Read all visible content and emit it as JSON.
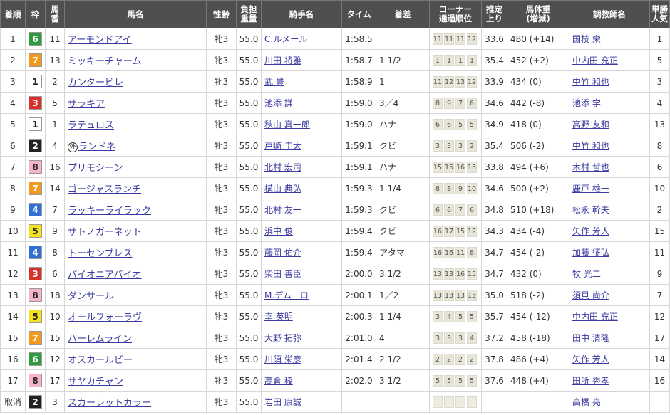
{
  "headers": [
    "着順",
    "枠",
    "馬番",
    "馬名",
    "性齢",
    "負担重量",
    "騎手名",
    "タイム",
    "着差",
    "コーナー通過順位",
    "推定上り",
    "馬体重(増減)",
    "調教師名",
    "単勝人気"
  ],
  "header_lines": {
    "umaban": [
      "馬",
      "番"
    ],
    "futan": [
      "負担",
      "重量"
    ],
    "corner": [
      "コーナー",
      "通過順位"
    ],
    "agari": [
      "推定",
      "上り"
    ],
    "weight": [
      "馬体重",
      "(増減)"
    ],
    "ninki": [
      "単勝",
      "人気"
    ]
  },
  "colors": {
    "header_bg": "#4f4f4f",
    "waku_1": "#ffffff",
    "waku_2": "#222222",
    "waku_3": "#d9302a",
    "waku_4": "#2f6fd6",
    "waku_5": "#f6e21c",
    "waku_6": "#2f9a3f",
    "waku_7": "#f39a1d",
    "waku_8": "#f7b4c8",
    "link": "#3a3aa0"
  },
  "rows": [
    {
      "pos": "1",
      "waku": "6",
      "uma": "11",
      "name": "アーモンドアイ",
      "prefix": "",
      "sex": "牝3",
      "kg": "55.0",
      "jockey": "C.ルメール",
      "time": "1:58.5",
      "margin": "",
      "corner": [
        "11",
        "11",
        "11",
        "12"
      ],
      "agari": "33.6",
      "weight": "480 (+14)",
      "trainer": "国枝 栄",
      "ninki": "1"
    },
    {
      "pos": "2",
      "waku": "7",
      "uma": "13",
      "name": "ミッキーチャーム",
      "prefix": "",
      "sex": "牝3",
      "kg": "55.0",
      "jockey": "川田 将雅",
      "time": "1:58.7",
      "margin": "1 1/2",
      "corner": [
        "1",
        "1",
        "1",
        "1"
      ],
      "agari": "35.4",
      "weight": "452 (+2)",
      "trainer": "中内田 充正",
      "ninki": "5"
    },
    {
      "pos": "3",
      "waku": "1",
      "uma": "2",
      "name": "カンタービレ",
      "prefix": "",
      "sex": "牝3",
      "kg": "55.0",
      "jockey": "武 豊",
      "time": "1:58.9",
      "margin": "1",
      "corner": [
        "11",
        "12",
        "13",
        "12"
      ],
      "agari": "33.9",
      "weight": "434 (0)",
      "trainer": "中竹 和也",
      "ninki": "3"
    },
    {
      "pos": "4",
      "waku": "3",
      "uma": "5",
      "name": "サラキア",
      "prefix": "",
      "sex": "牝3",
      "kg": "55.0",
      "jockey": "池添 謙一",
      "time": "1:59.0",
      "margin": "3／4",
      "corner": [
        "8",
        "9",
        "7",
        "6"
      ],
      "agari": "34.6",
      "weight": "442 (-8)",
      "trainer": "池添 学",
      "ninki": "4"
    },
    {
      "pos": "5",
      "waku": "1",
      "uma": "1",
      "name": "ラテュロス",
      "prefix": "",
      "sex": "牝3",
      "kg": "55.0",
      "jockey": "秋山 真一郎",
      "time": "1:59.0",
      "margin": "ハナ",
      "corner": [
        "6",
        "6",
        "5",
        "5"
      ],
      "agari": "34.9",
      "weight": "418 (0)",
      "trainer": "高野 友和",
      "ninki": "13"
    },
    {
      "pos": "6",
      "waku": "2",
      "uma": "4",
      "name": "ランドネ",
      "prefix": "外",
      "sex": "牝3",
      "kg": "55.0",
      "jockey": "戸崎 圭太",
      "time": "1:59.1",
      "margin": "クビ",
      "corner": [
        "3",
        "3",
        "3",
        "2"
      ],
      "agari": "35.4",
      "weight": "506 (-2)",
      "trainer": "中竹 和也",
      "ninki": "8"
    },
    {
      "pos": "7",
      "waku": "8",
      "uma": "16",
      "name": "プリモシーン",
      "prefix": "",
      "sex": "牝3",
      "kg": "55.0",
      "jockey": "北村 宏司",
      "time": "1:59.1",
      "margin": "ハナ",
      "corner": [
        "15",
        "15",
        "16",
        "15"
      ],
      "agari": "33.8",
      "weight": "494 (+6)",
      "trainer": "木村 哲也",
      "ninki": "6"
    },
    {
      "pos": "8",
      "waku": "7",
      "uma": "14",
      "name": "ゴージャスランチ",
      "prefix": "",
      "sex": "牝3",
      "kg": "55.0",
      "jockey": "横山 典弘",
      "time": "1:59.3",
      "margin": "1 1/4",
      "corner": [
        "8",
        "8",
        "9",
        "10"
      ],
      "agari": "34.6",
      "weight": "500 (+2)",
      "trainer": "鹿戸 雄一",
      "ninki": "10"
    },
    {
      "pos": "9",
      "waku": "4",
      "uma": "7",
      "name": "ラッキーライラック",
      "prefix": "",
      "sex": "牝3",
      "kg": "55.0",
      "jockey": "北村 友一",
      "time": "1:59.3",
      "margin": "クビ",
      "corner": [
        "6",
        "6",
        "7",
        "6"
      ],
      "agari": "34.8",
      "weight": "510 (+18)",
      "trainer": "松永 幹夫",
      "ninki": "2"
    },
    {
      "pos": "10",
      "waku": "5",
      "uma": "9",
      "name": "サトノガーネット",
      "prefix": "",
      "sex": "牝3",
      "kg": "55.0",
      "jockey": "浜中 俊",
      "time": "1:59.4",
      "margin": "クビ",
      "corner": [
        "16",
        "17",
        "15",
        "12"
      ],
      "agari": "34.3",
      "weight": "434 (-4)",
      "trainer": "矢作 芳人",
      "ninki": "15"
    },
    {
      "pos": "11",
      "waku": "4",
      "uma": "8",
      "name": "トーセンブレス",
      "prefix": "",
      "sex": "牝3",
      "kg": "55.0",
      "jockey": "藤岡 佑介",
      "time": "1:59.4",
      "margin": "アタマ",
      "corner": [
        "16",
        "16",
        "11",
        "8"
      ],
      "agari": "34.7",
      "weight": "454 (-2)",
      "trainer": "加藤 征弘",
      "ninki": "11"
    },
    {
      "pos": "12",
      "waku": "3",
      "uma": "6",
      "name": "パイオニアバイオ",
      "prefix": "",
      "sex": "牝3",
      "kg": "55.0",
      "jockey": "柴田 善臣",
      "time": "2:00.0",
      "margin": "3 1/2",
      "corner": [
        "13",
        "13",
        "16",
        "15"
      ],
      "agari": "34.7",
      "weight": "432 (0)",
      "trainer": "牧 光二",
      "ninki": "9"
    },
    {
      "pos": "13",
      "waku": "8",
      "uma": "18",
      "name": "ダンサール",
      "prefix": "",
      "sex": "牝3",
      "kg": "55.0",
      "jockey": "M.デムーロ",
      "time": "2:00.1",
      "margin": "1／2",
      "corner": [
        "13",
        "13",
        "13",
        "15"
      ],
      "agari": "35.0",
      "weight": "518 (-2)",
      "trainer": "須貝 尚介",
      "ninki": "7"
    },
    {
      "pos": "14",
      "waku": "5",
      "uma": "10",
      "name": "オールフォーラヴ",
      "prefix": "",
      "sex": "牝3",
      "kg": "55.0",
      "jockey": "幸 英明",
      "time": "2:00.3",
      "margin": "1 1/4",
      "corner": [
        "3",
        "4",
        "5",
        "5"
      ],
      "agari": "35.7",
      "weight": "454 (-12)",
      "trainer": "中内田 充正",
      "ninki": "12"
    },
    {
      "pos": "15",
      "waku": "7",
      "uma": "15",
      "name": "ハーレムライン",
      "prefix": "",
      "sex": "牝3",
      "kg": "55.0",
      "jockey": "大野 拓弥",
      "time": "2:01.0",
      "margin": "4",
      "corner": [
        "3",
        "3",
        "3",
        "4"
      ],
      "agari": "37.2",
      "weight": "458 (-18)",
      "trainer": "田中 清隆",
      "ninki": "17"
    },
    {
      "pos": "16",
      "waku": "6",
      "uma": "12",
      "name": "オスカールビー",
      "prefix": "",
      "sex": "牝3",
      "kg": "55.0",
      "jockey": "川須 栄彦",
      "time": "2:01.4",
      "margin": "2 1/2",
      "corner": [
        "2",
        "2",
        "2",
        "2"
      ],
      "agari": "37.8",
      "weight": "486 (+4)",
      "trainer": "矢作 芳人",
      "ninki": "14"
    },
    {
      "pos": "17",
      "waku": "8",
      "uma": "17",
      "name": "サヤカチャン",
      "prefix": "",
      "sex": "牝3",
      "kg": "55.0",
      "jockey": "高倉 稜",
      "time": "2:02.0",
      "margin": "3 1/2",
      "corner": [
        "5",
        "5",
        "5",
        "5"
      ],
      "agari": "37.6",
      "weight": "448 (+4)",
      "trainer": "田所 秀孝",
      "ninki": "16"
    },
    {
      "pos": "取消",
      "waku": "2",
      "uma": "3",
      "name": "スカーレットカラー",
      "prefix": "",
      "sex": "牝3",
      "kg": "55.0",
      "jockey": "岩田 康誠",
      "time": "",
      "margin": "",
      "corner": [
        "",
        "",
        "",
        ""
      ],
      "agari": "",
      "weight": "",
      "trainer": "高橋 亮",
      "ninki": ""
    }
  ]
}
